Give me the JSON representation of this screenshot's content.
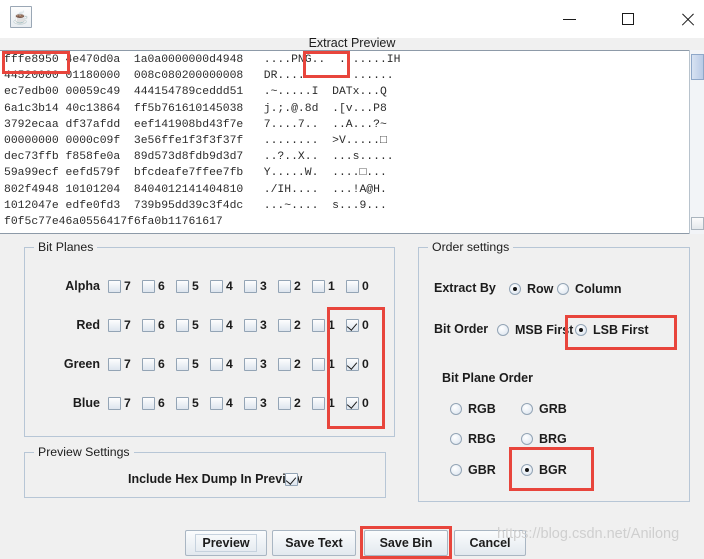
{
  "window": {
    "app_icon": "java-coffee-cup-icon",
    "minimize_label": "—",
    "maximize_label": "□",
    "close_label": "✕"
  },
  "preview": {
    "title": "Extract Preview",
    "hex_rows": [
      {
        "col1": "fffe8950",
        "col1b": "4e470d0a",
        "col2": "1a0a0000000d4948",
        "ascii": "....PNG.. .......IH"
      },
      {
        "col1": "44520000",
        "col1b": "01180000",
        "col2": "008c080200000008",
        "ascii": "DR....... ........"
      },
      {
        "col1": "ec7edb00",
        "col1b": "00059c49",
        "col2": "444154789ceddd51",
        "ascii": ".~.....I DATx...Q"
      },
      {
        "col1": "6a1c3b14",
        "col1b": "40c13864",
        "col2": "ff5b761610145038",
        "ascii": "j.;.@.8d .[v...P8"
      },
      {
        "col1": "3792ecaa",
        "col1b": "df37afdd",
        "col2": "eef141908bd43f7e",
        "ascii": "7....7.. ..A...?~"
      },
      {
        "col1": "00000000",
        "col1b": "0000c09f",
        "col2": "3e56ffe1f3f3f37f",
        "ascii": "........ >V.....□"
      },
      {
        "col1": "dec73ffb",
        "col1b": "f858fe0a",
        "col2": "89d573d8fdb9d3d7",
        "ascii": "..?..X.. ...s....."
      },
      {
        "col1": "59a99ecf",
        "col1b": "eefd579f",
        "col2": "bfcdeafe7ffee7fb",
        "ascii": "Y.....W. ....□..."
      },
      {
        "col1": "802f4948",
        "col1b": "10101204",
        "col2": "840401214 1404810",
        "ascii": "./IH.... ...!A@H."
      },
      {
        "col1": "1012047e",
        "col1b": "edfe0fd3",
        "col2": "739b95dd39c3f4dc",
        "ascii": "...~.... s...9..."
      }
    ],
    "hex_rows_display": [
      "fffe8950 4e470d0a  1a0a0000000d4948   ....PNG..  .......IH",
      "44520000 01180000  008c080200000008   DR.......  ........",
      "ec7edb00 00059c49  444154789ceddd51   .~.....I  DATx...Q",
      "6a1c3b14 40c13864  ff5b761610145038   j.;.@.8d  .[v...P8",
      "3792ecaa df37afdd  eef141908bd43f7e   7....7..  ..A...?~",
      "00000000 0000c09f  3e56ffe1f3f3f37f   ........  >V.....□",
      "dec73ffb f858fe0a  89d573d8fdb9d3d7   ..?..X..  ...s.....",
      "59a99ecf eefd579f  bfcdeafe7ffee7fb   Y.....W.  ....□...",
      "802f4948 10101204  8404012141404810   ./IH....  ...!A@H.",
      "1012047e edfe0fd3  739b95dd39c3f4dc   ...~....  s...9..."
    ]
  },
  "bit_planes": {
    "title": "Bit Planes",
    "bit_labels": [
      "7",
      "6",
      "5",
      "4",
      "3",
      "2",
      "1",
      "0"
    ],
    "channels": [
      {
        "name": "Alpha",
        "checked": [
          false,
          false,
          false,
          false,
          false,
          false,
          false,
          false
        ]
      },
      {
        "name": "Red",
        "checked": [
          false,
          false,
          false,
          false,
          false,
          false,
          false,
          true
        ]
      },
      {
        "name": "Green",
        "checked": [
          false,
          false,
          false,
          false,
          false,
          false,
          false,
          true
        ]
      },
      {
        "name": "Blue",
        "checked": [
          false,
          false,
          false,
          false,
          false,
          false,
          false,
          true
        ]
      }
    ]
  },
  "order_settings": {
    "title": "Order settings",
    "extract_by": {
      "label": "Extract By",
      "options": [
        "Row",
        "Column"
      ],
      "selected": "Row"
    },
    "bit_order": {
      "label": "Bit Order",
      "options": [
        "MSB First",
        "LSB First"
      ],
      "selected": "LSB First"
    },
    "bit_plane_order": {
      "label": "Bit Plane Order",
      "options": [
        "RGB",
        "GRB",
        "RBG",
        "BRG",
        "GBR",
        "BGR"
      ],
      "selected": "BGR"
    }
  },
  "preview_settings": {
    "title": "Preview Settings",
    "include_hex_dump_label": "Include Hex Dump In Preview",
    "include_hex_dump_checked": true
  },
  "buttons": {
    "preview": "Preview",
    "save_text": "Save Text",
    "save_bin": "Save Bin",
    "cancel": "Cancel"
  },
  "watermark": "https://blog.csdn.net/Anilong",
  "colors": {
    "annotation": "#e8453c",
    "panel_bg": "#f0f0f0",
    "hex_bg": "#ffffff",
    "group_border": "#b7c6d6"
  }
}
